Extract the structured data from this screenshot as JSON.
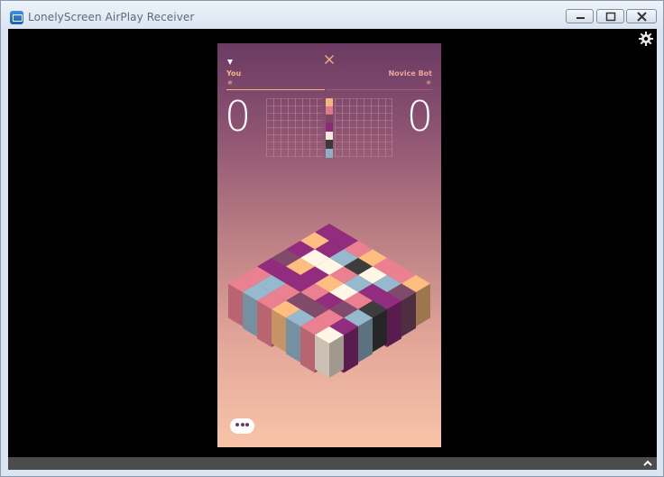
{
  "window": {
    "title": "LonelyScreen AirPlay Receiver",
    "icon": "airplay-screen-icon",
    "controls": [
      "minimize-icon",
      "maximize-icon",
      "close-icon"
    ]
  },
  "toolbar": {
    "settings_icon": "gear-icon",
    "expand_icon": "chevron-up-icon"
  },
  "game": {
    "close_icon": "close-icon",
    "menu_icon": "triangle-down-icon",
    "player": {
      "name": "You",
      "score": "0",
      "marker": "✵"
    },
    "opponent": {
      "name": "Novice Bot",
      "score": "0",
      "marker": "✵"
    },
    "palette": [
      "#f2b57a",
      "#e07a8a",
      "#7a4766",
      "#8a2a78",
      "#f7eadb",
      "#3a3a3a",
      "#8fb0c4"
    ],
    "more_icon": "ellipsis-icon",
    "colors": {
      "accent": "#f3b784",
      "bg_top": "#6b3a63",
      "bg_bottom": "#f8c4a8"
    }
  }
}
